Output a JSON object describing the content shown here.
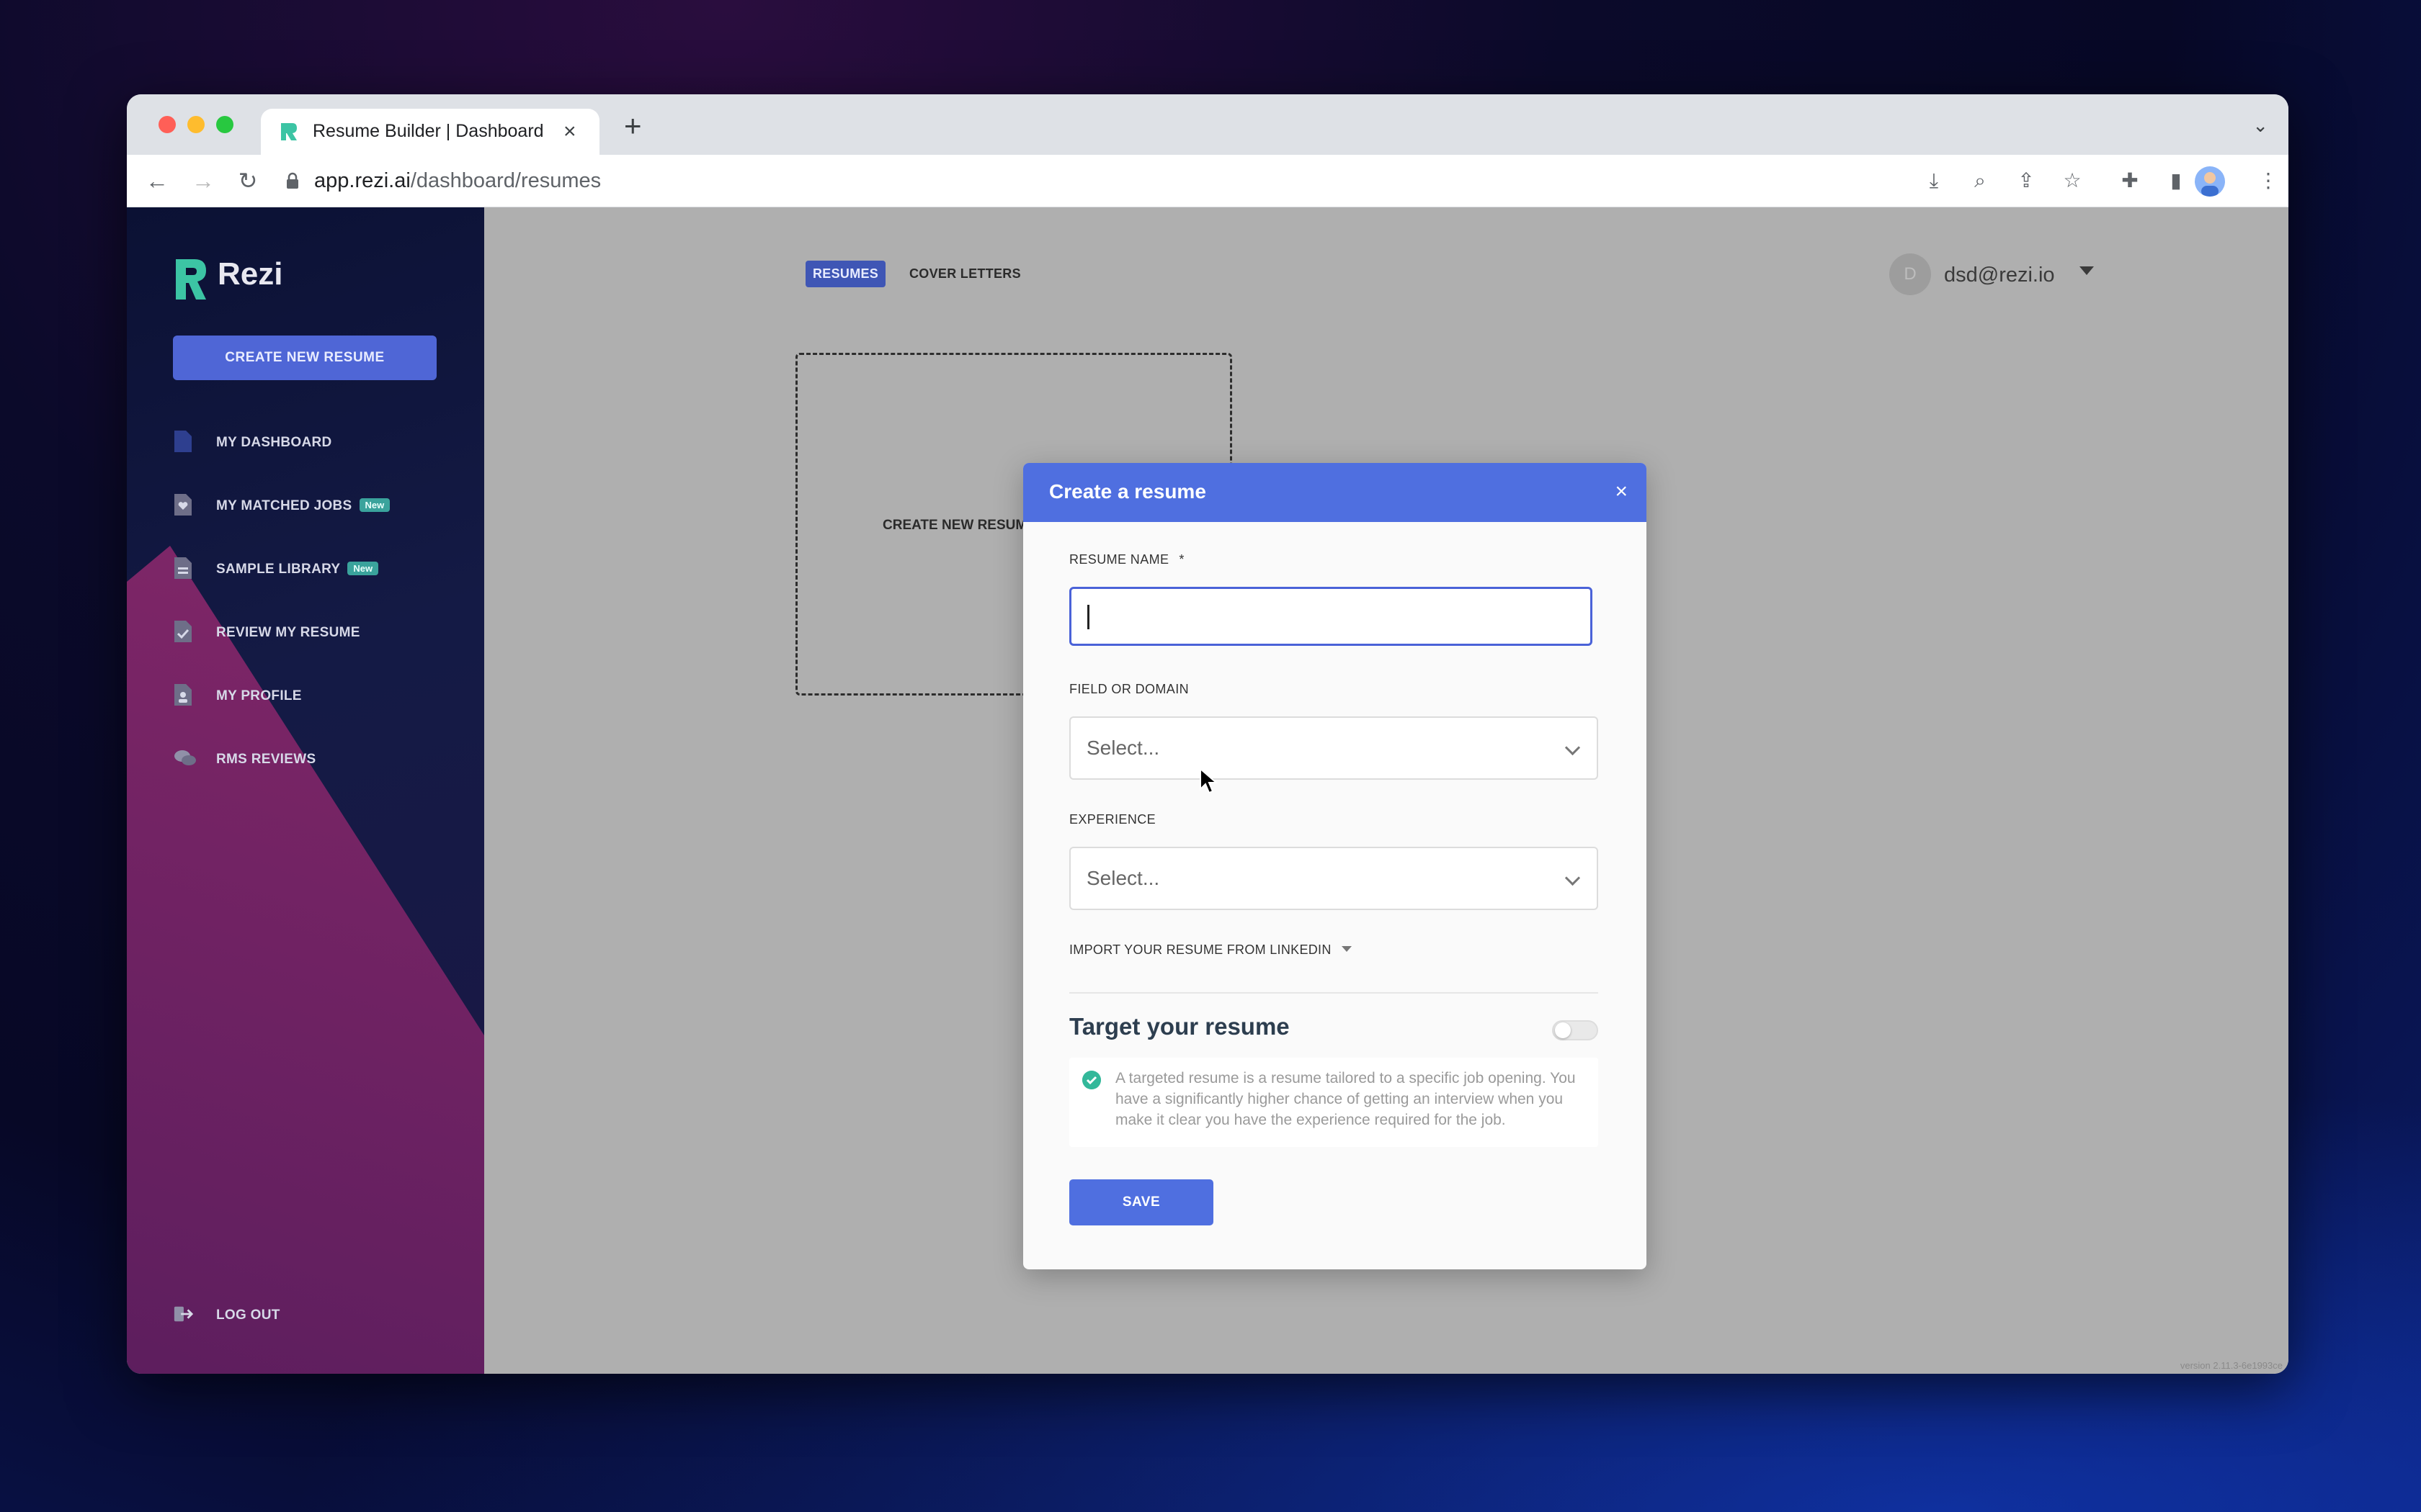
{
  "browser": {
    "tab_title": "Resume Builder | Dashboard",
    "url_host": "app.rezi.ai",
    "url_path": "/dashboard/resumes",
    "tab_close": "×",
    "new_tab": "+"
  },
  "sidebar": {
    "logo_text": "Rezi",
    "create_button": "CREATE NEW RESUME",
    "items": [
      {
        "label": "MY DASHBOARD",
        "badge": ""
      },
      {
        "label": "MY MATCHED JOBS",
        "badge": "New"
      },
      {
        "label": "SAMPLE LIBRARY",
        "badge": "New"
      },
      {
        "label": "REVIEW MY RESUME",
        "badge": ""
      },
      {
        "label": "MY PROFILE",
        "badge": ""
      },
      {
        "label": "RMS REVIEWS",
        "badge": ""
      }
    ],
    "logout": "LOG OUT"
  },
  "main": {
    "tabs": [
      {
        "label": "RESUMES",
        "active": true
      },
      {
        "label": "COVER LETTERS",
        "active": false
      }
    ],
    "new_card_label": "CREATE NEW RESUME",
    "user": {
      "initial": "D",
      "email": "dsd@rezi.io"
    },
    "version": "version 2.11.3-6e1993ce"
  },
  "modal": {
    "title": "Create a resume",
    "close": "×",
    "resume_name_label": "RESUME NAME",
    "required_mark": "*",
    "resume_name_value": "",
    "field_label": "FIELD OR DOMAIN",
    "field_value": "Select...",
    "experience_label": "EXPERIENCE",
    "experience_value": "Select...",
    "linkedin_label": "IMPORT YOUR RESUME FROM LINKEDIN",
    "target_title": "Target your resume",
    "target_enabled": false,
    "target_info": "A targeted resume is a resume tailored to a specific job opening. You have a significantly higher chance of getting an interview when you make it clear you have the experience required for the job.",
    "save_button": "SAVE"
  },
  "colors": {
    "accent": "#4f6fe0",
    "sidebar_dark": "#0b1134",
    "sidebar_magenta": "#7b2566",
    "badge_teal": "#3aa39c",
    "check_green": "#33b89a"
  }
}
